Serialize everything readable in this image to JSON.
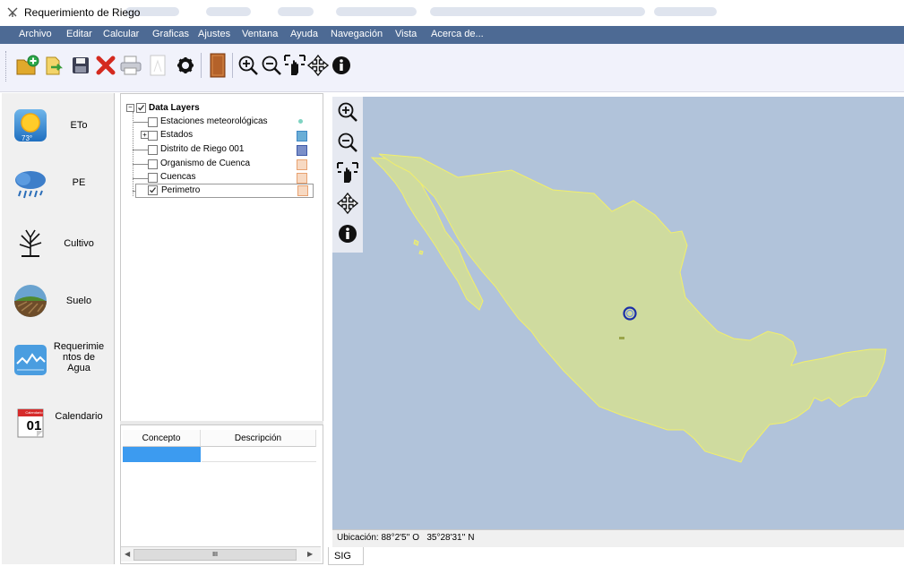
{
  "window": {
    "title": "Requerimiento de Riego"
  },
  "menu": [
    "Archivo",
    "Editar",
    "Calcular",
    "Graficas",
    "Ajustes",
    "Ventana",
    "Ayuda",
    "Navegación",
    "Vista",
    "Acerca de..."
  ],
  "toolbar": {
    "icons": [
      "open-folder-add-icon",
      "import-icon",
      "save-icon",
      "delete-icon",
      "print-icon",
      "document-icon",
      "settings-icon",
      "book-icon",
      "zoom-in-icon",
      "zoom-out-icon",
      "zoom-extent-icon",
      "pan-icon",
      "info-icon"
    ]
  },
  "sidebar": {
    "items": [
      {
        "label": "ETo",
        "icon": "sun-temperature-icon"
      },
      {
        "label": "PE",
        "icon": "rain-cloud-icon"
      },
      {
        "label": "Cultivo",
        "icon": "plant-icon"
      },
      {
        "label": "Suelo",
        "icon": "soil-field-icon"
      },
      {
        "label": "Requerimie\nntos de\nAgua",
        "icon": "water-chart-icon"
      },
      {
        "label": "Calendario",
        "icon": "calendar-icon"
      }
    ],
    "calendar_day": "01",
    "calendar_header": "Calendario",
    "eto_temp": "73°"
  },
  "layers": {
    "root": "Data Layers",
    "items": [
      {
        "label": "Estaciones meteorológicas",
        "checked": false,
        "expandable": false,
        "color": "#7fd3c2"
      },
      {
        "label": "Estados",
        "checked": false,
        "expandable": true,
        "color": "#6aaed6"
      },
      {
        "label": "Distrito de Riego 001",
        "checked": false,
        "expandable": false,
        "color": "#7b8fc8"
      },
      {
        "label": "Organismo de Cuenca",
        "checked": false,
        "expandable": false,
        "color": "#f3c7a5"
      },
      {
        "label": "Cuencas",
        "checked": false,
        "expandable": false,
        "color": "#f3c7a5"
      },
      {
        "label": "Perimetro",
        "checked": true,
        "expandable": false,
        "color": "#f3c7a5"
      }
    ]
  },
  "table": {
    "columns": [
      "Concepto",
      "Descripción"
    ],
    "scroll_grip": "III"
  },
  "map": {
    "tools": [
      "zoom-in-icon",
      "zoom-out-icon",
      "zoom-extent-icon",
      "pan-icon",
      "info-icon"
    ],
    "status": "Ubicación: 88°2'5'' O   35°28'31'' N",
    "tab": "SIG",
    "colors": {
      "water": "#b1c3da",
      "land": "#cfdb9f",
      "border": "#f2ef6a",
      "marker": "#1b2fa8"
    }
  }
}
